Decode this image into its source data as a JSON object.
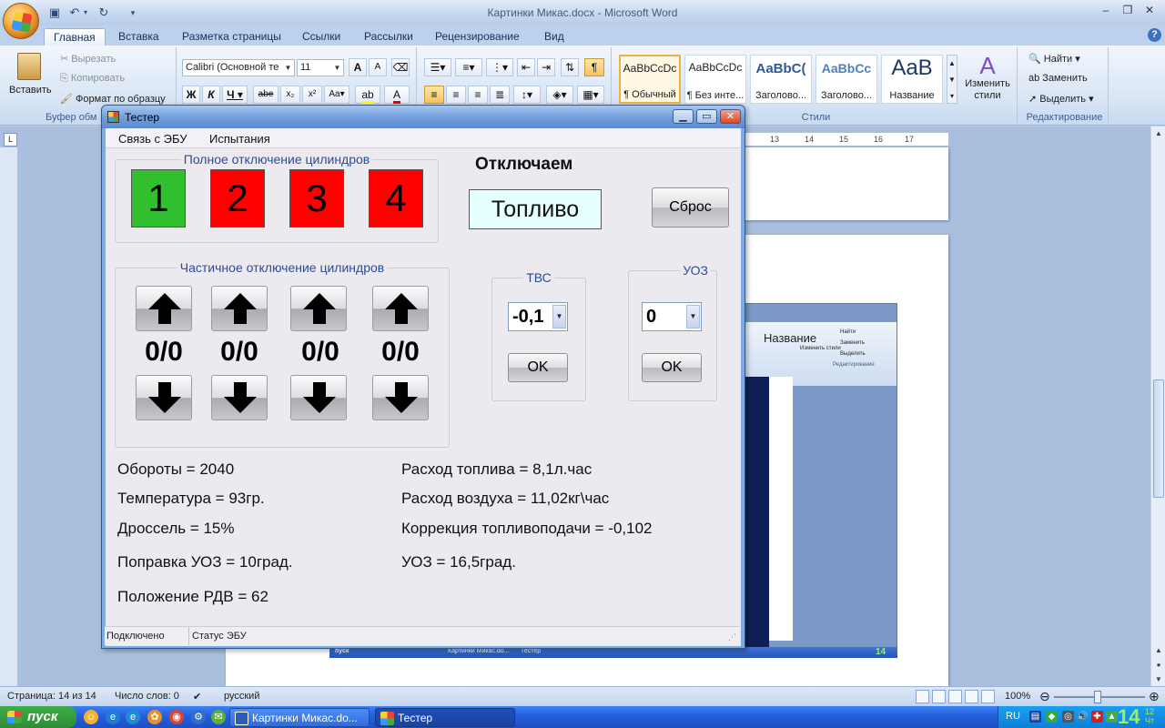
{
  "word": {
    "title": "Картинки Микас.docx - Microsoft Word",
    "tabs": [
      "Главная",
      "Вставка",
      "Разметка страницы",
      "Ссылки",
      "Рассылки",
      "Рецензирование",
      "Вид"
    ],
    "active_tab": "Главная",
    "clipboard": {
      "paste": "Вставить",
      "cut": "Вырезать",
      "copy": "Копировать",
      "format_painter": "Формат по образцу",
      "group_label": "Буфер обм"
    },
    "font": {
      "name": "Calibri (Основной те",
      "size": "11"
    },
    "styles": {
      "items": [
        {
          "sample": "AaBbCcDc",
          "name": "¶ Обычный",
          "active": true
        },
        {
          "sample": "AaBbCcDc",
          "name": "¶ Без инте..."
        },
        {
          "sample": "AaBbC(",
          "name": "Заголово..."
        },
        {
          "sample": "AaBbCc",
          "name": "Заголово..."
        },
        {
          "sample": "AaB",
          "name": "Название"
        }
      ],
      "change_styles": "Изменить стили",
      "group_label": "Стили"
    },
    "editing": {
      "find": "Найти",
      "replace": "Заменить",
      "select": "Выделить",
      "group_label": "Редактирование"
    },
    "ruler_ticks": [
      "13",
      "14",
      "15",
      "16",
      "17"
    ],
    "status": {
      "page": "Страница: 14 из 14",
      "words": "Число слов: 0",
      "language": "русский",
      "zoom": "100%"
    }
  },
  "tester": {
    "title": "Тестер",
    "menu": [
      "Связь с ЭБУ",
      "Испытания"
    ],
    "full_shutdown": {
      "legend": "Полное отключение цилиндров",
      "cylinders": [
        {
          "label": "1",
          "color": "#2fbf2f"
        },
        {
          "label": "2",
          "color": "#ff0000"
        },
        {
          "label": "3",
          "color": "#ff0000"
        },
        {
          "label": "4",
          "color": "#ff0000"
        }
      ]
    },
    "shutdown_heading": "Отключаем",
    "shutdown_value": "Топливо",
    "reset_button": "Сброс",
    "partial_shutdown": {
      "legend": "Частичное отключение цилиндров",
      "counters": [
        "0/0",
        "0/0",
        "0/0",
        "0/0"
      ]
    },
    "tvs": {
      "legend": "ТВС",
      "value": "-0,1",
      "ok": "OK"
    },
    "uoz": {
      "legend": "УОЗ",
      "value": "0",
      "ok": "OK"
    },
    "params_left": [
      "Обороты = 2040",
      "Температура = 93гр.",
      "Дроссель = 15%",
      "Поправка УОЗ = 10град.",
      "Положение РДВ = 62"
    ],
    "params_right": [
      "Расход топлива = 8,1л.час",
      "Расход воздуха = 11,02кг\\час",
      "Коррекция топливоподачи = -0,102",
      "УОЗ = 16,5град."
    ],
    "status_connection": "Подключено",
    "status_ecu": "Статус ЭБУ"
  },
  "embedded_screenshot": {
    "ribbon_labels": [
      "Найти",
      "Заменить",
      "Выделить",
      "Редактирование",
      "Название",
      "Изменить стили"
    ],
    "taskbar": [
      "пуск",
      "Картинки Микас.do...",
      "Тестер"
    ],
    "clock": "14"
  },
  "taskbar": {
    "start": "пуск",
    "items": [
      "Картинки Микас.do...",
      "Тестер"
    ],
    "language": "RU",
    "clock": "14",
    "clock_small": "12",
    "clock_day": "Чт"
  }
}
